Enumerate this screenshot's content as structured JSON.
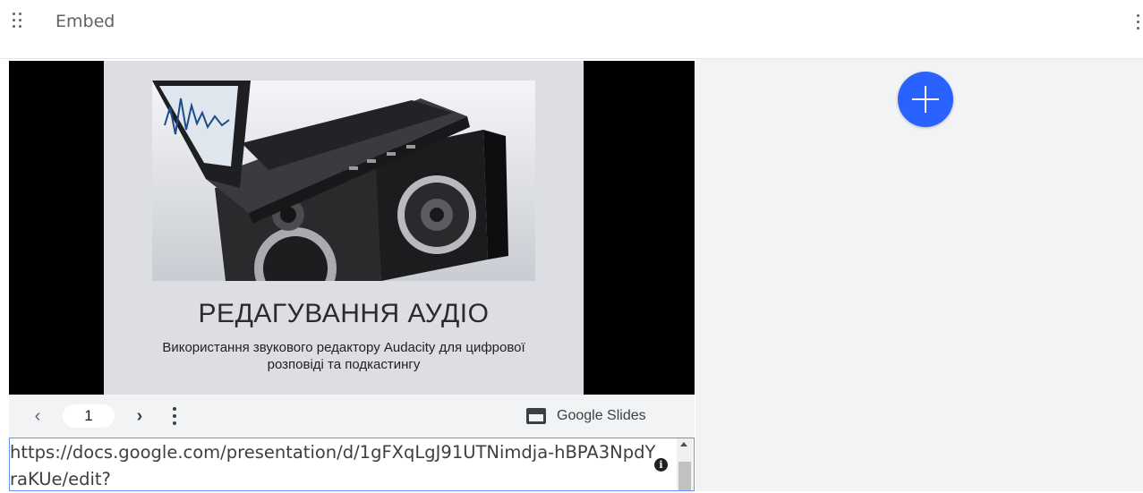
{
  "header": {
    "title": "Embed",
    "drag_icon": "drag-handle-icon",
    "more_icon": "more-vert-icon"
  },
  "slide": {
    "title": "РЕДАГУВАННЯ АУДІО",
    "subtitle": "Використання звукового редактору Audacity для цифрової розповіді та подкастингу",
    "image": "laptop-on-speakers-photo"
  },
  "controls": {
    "prev_icon": "chevron-left-icon",
    "page_number": "1",
    "next_icon": "chevron-right-icon",
    "menu_icon": "more-vert-icon",
    "brand_label": "Google Slides",
    "brand_icon": "google-slides-icon"
  },
  "url_field": {
    "value": "https://docs.google.com/presentation/d/1gFXqLgJ91UTNimdja-hBPA3NpdYraKUe/edit?",
    "info_icon": "info-icon"
  },
  "right_panel": {
    "add_icon": "add-icon"
  },
  "colors": {
    "accent": "#2962ff",
    "panel_bg": "#f1f3f4",
    "text": "#5f6368",
    "focus_border": "#6b8ff0"
  }
}
